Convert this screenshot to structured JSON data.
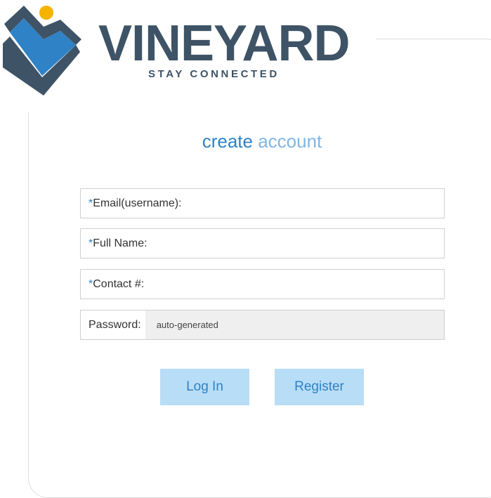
{
  "brand": {
    "name": "VINEYARD",
    "tagline": "STAY CONNECTED"
  },
  "heading": {
    "word1": "create",
    "word2": "account"
  },
  "form": {
    "email": {
      "required_mark": "*",
      "label": "Email(username):",
      "value": ""
    },
    "full_name": {
      "required_mark": "*",
      "label": "Full Name:",
      "value": ""
    },
    "contact": {
      "required_mark": "*",
      "label": "Contact #:",
      "value": ""
    },
    "password": {
      "label": "Password:",
      "value": "auto-generated"
    }
  },
  "buttons": {
    "login": "Log In",
    "register": "Register"
  },
  "colors": {
    "brand_dark": "#3e5366",
    "accent_blue": "#2f82c6",
    "light_blue": "#7fb6e4",
    "sun": "#f5b400",
    "button_bg": "#b8ddf7"
  }
}
